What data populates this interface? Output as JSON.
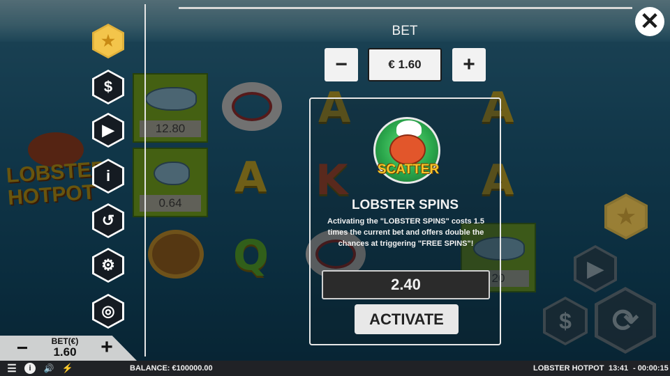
{
  "bet_panel": {
    "title": "BET",
    "minus_label": "−",
    "plus_label": "+",
    "bet_value": "€ 1.60"
  },
  "feature": {
    "scatter_label": "SCATTER",
    "title": "LOBSTER SPINS",
    "description": "Activating the \"LOBSTER SPINS\" costs 1.5 times the current bet and offers double the chances at triggering \"FREE SPINS\"!",
    "cost": "2.40",
    "activate_label": "ACTIVATE"
  },
  "close_label": "✕",
  "game_logo": {
    "line1": "LOBSTER",
    "line2": "HOTPOT"
  },
  "reels": {
    "wins": [
      "12.80",
      "0.64",
      "20"
    ],
    "symbols": [
      "A",
      "A",
      "K",
      "A",
      "A",
      "Q",
      "A"
    ]
  },
  "side_menu": {
    "icons": [
      "star-icon",
      "dollar-icon",
      "play-icon",
      "info-icon",
      "history-icon",
      "settings-icon",
      "speed-icon"
    ],
    "dollar_glyph": "$",
    "play_glyph": "▶",
    "info_glyph": "i",
    "history_glyph": "↺",
    "settings_glyph": "⚙",
    "speed_glyph": "◎",
    "star_glyph": "★"
  },
  "bet_widget": {
    "label": "BET(€)",
    "value": "1.60",
    "minus": "−",
    "plus": "+"
  },
  "right_controls": {
    "star_glyph": "★",
    "play_glyph": "▶",
    "dollar_glyph": "$",
    "spin_glyph": "⟳"
  },
  "status_bar": {
    "menu_glyph": "☰",
    "info_glyph": "i",
    "sound_glyph": "🔊",
    "bolt_glyph": "⚡",
    "balance": "BALANCE: €100000.00",
    "game_name": "LOBSTER HOTPOT",
    "time": "13:41",
    "elapsed": "- 00:00:15"
  },
  "colors": {
    "background": "#1d5a78",
    "panel_border": "#e8e8e8",
    "scatter_gold": "#f7c52a",
    "tile_green": "#6f9c1e",
    "statusbar": "#202226"
  }
}
